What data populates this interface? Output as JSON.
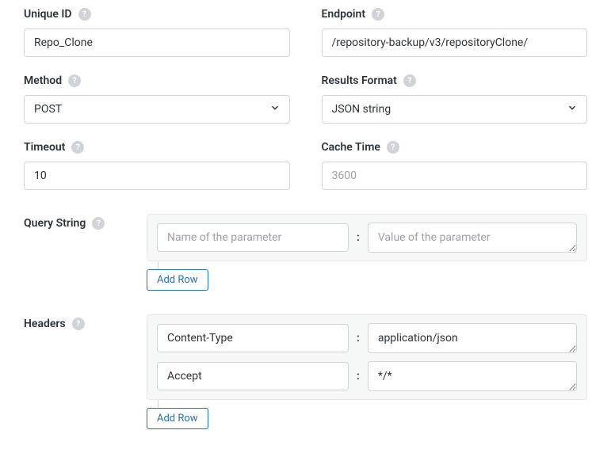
{
  "fields": {
    "unique_id": {
      "label": "Unique ID",
      "value": "Repo_Clone"
    },
    "endpoint": {
      "label": "Endpoint",
      "value": "/repository-backup/v3/repositoryClone/"
    },
    "method": {
      "label": "Method",
      "value": "POST"
    },
    "results_format": {
      "label": "Results Format",
      "value": "JSON string"
    },
    "timeout": {
      "label": "Timeout",
      "value": "10"
    },
    "cache_time": {
      "label": "Cache Time",
      "placeholder": "3600",
      "value": ""
    }
  },
  "query_string": {
    "label": "Query String",
    "name_placeholder": "Name of the parameter",
    "value_placeholder": "Value of the parameter",
    "rows": [
      {
        "name": "",
        "value": ""
      }
    ],
    "add_row_label": "Add Row"
  },
  "headers": {
    "label": "Headers",
    "name_placeholder": "Name of the parameter",
    "value_placeholder": "Value of the parameter",
    "rows": [
      {
        "name": "Content-Type",
        "value": "application/json"
      },
      {
        "name": "Accept",
        "value": "*/*"
      }
    ],
    "add_row_label": "Add Row"
  }
}
